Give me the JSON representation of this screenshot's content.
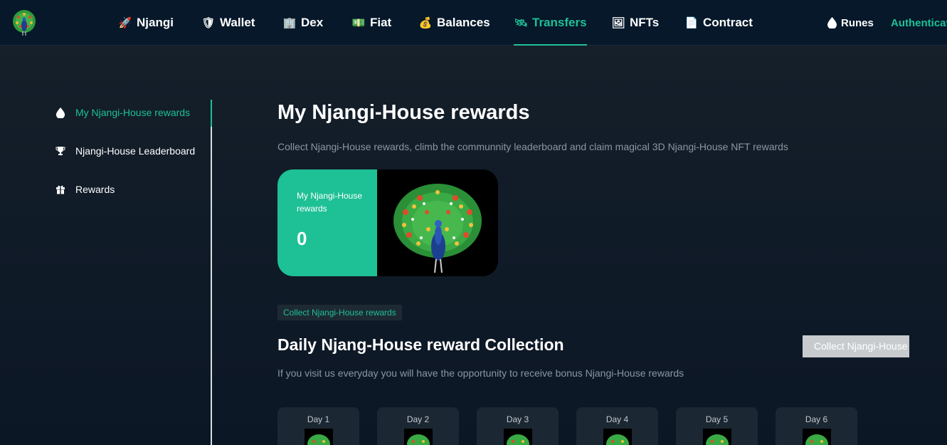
{
  "nav": {
    "items": [
      {
        "label": "Njangi",
        "icon": "rocket-icon",
        "glyph": "🚀"
      },
      {
        "label": "Wallet",
        "icon": "shield-icon",
        "glyph": "🛡"
      },
      {
        "label": "Dex",
        "icon": "building-icon",
        "glyph": "🏢"
      },
      {
        "label": "Fiat",
        "icon": "cash-icon",
        "glyph": "💵"
      },
      {
        "label": "Balances",
        "icon": "money-bag-icon",
        "glyph": "💰"
      },
      {
        "label": "Transfers",
        "icon": "satellite-icon",
        "glyph": "🛰"
      },
      {
        "label": "NFTs",
        "icon": "frame-icon",
        "glyph": "🖼"
      },
      {
        "label": "Contract",
        "icon": "document-icon",
        "glyph": "📄"
      }
    ],
    "active": "Transfers",
    "runes_label": "Runes",
    "auth_label": "Authenticat"
  },
  "sidebar": {
    "items": [
      {
        "label": "My Njangi-House rewards",
        "icon": "drop-icon"
      },
      {
        "label": "Njangi-House Leaderboard",
        "icon": "trophy-icon"
      },
      {
        "label": "Rewards",
        "icon": "gift-icon"
      }
    ]
  },
  "main": {
    "title": "My Njangi-House rewards",
    "subtitle": "Collect Njangi-House rewards, climb the communnity leaderboard and claim magical 3D Njangi-House NFT rewards",
    "card_label": "My Njangi-House rewards",
    "card_value": "0",
    "tag": "Collect Njangi-House rewards",
    "daily_title": "Daily Njang-House reward Collection",
    "collect_button": "Collect Njangi-House",
    "daily_subtitle": "If you visit us everyday you will have the opportunity to receive bonus Njangi-House rewards",
    "days": [
      "Day 1",
      "Day 2",
      "Day 3",
      "Day 4",
      "Day 5",
      "Day 6"
    ]
  },
  "colors": {
    "accent": "#1ec095",
    "nav_bg": "#06182a",
    "button_disabled": "#c8cbce"
  }
}
